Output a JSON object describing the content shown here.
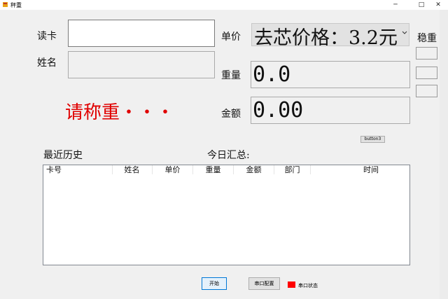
{
  "window": {
    "title": "秤重",
    "min_glyph": "─",
    "max_glyph": "□",
    "close_glyph": "✕"
  },
  "form": {
    "card_label": "读卡",
    "card_value": "",
    "name_label": "姓名",
    "name_value": "",
    "price_label": "单价",
    "price_selected": "去芯价格：3.2元",
    "weight_label": "重量",
    "weight_value": "0.0",
    "amount_label": "金额",
    "amount_value": "0.00",
    "stable_label": "稳重",
    "status_message": "请称重・・・",
    "button3_label": "button3"
  },
  "history": {
    "title": "最近历史",
    "summary_label": "今日汇总:",
    "columns": [
      "卡号",
      "姓名",
      "单价",
      "重量",
      "金额",
      "部门",
      "时间"
    ],
    "rows": []
  },
  "footer": {
    "start_label": "开始",
    "serial_config_label": "串口配置",
    "serial_status_label": "串口状态",
    "serial_status_color": "#ff0000"
  },
  "icons": {
    "app_icon": "scale-app-icon",
    "dropdown": "chevron-down-icon"
  }
}
